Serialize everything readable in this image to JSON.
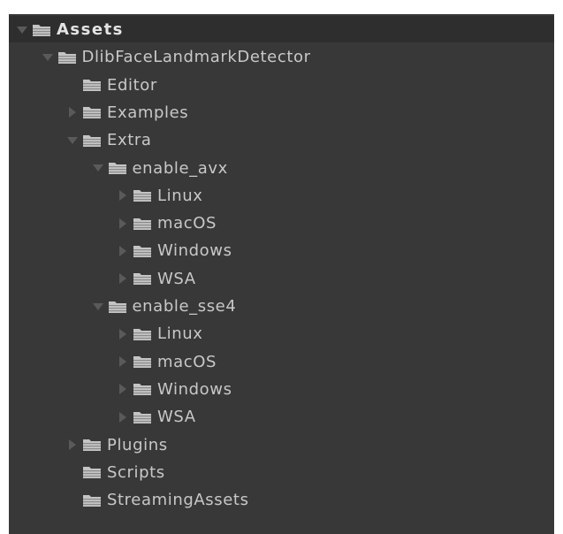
{
  "colors": {
    "panel_bg": "#383838",
    "header_bg": "#2e2e2e",
    "text": "#c8c8c8",
    "arrow": "#5a5a5a",
    "folder": "#c4c4c4"
  },
  "tree": {
    "rows": [
      {
        "label": "Assets",
        "depth": 0,
        "arrow": "expanded",
        "root": true
      },
      {
        "label": "DlibFaceLandmarkDetector",
        "depth": 1,
        "arrow": "expanded"
      },
      {
        "label": "Editor",
        "depth": 2,
        "arrow": "none"
      },
      {
        "label": "Examples",
        "depth": 2,
        "arrow": "collapsed"
      },
      {
        "label": "Extra",
        "depth": 2,
        "arrow": "expanded"
      },
      {
        "label": "enable_avx",
        "depth": 3,
        "arrow": "expanded"
      },
      {
        "label": "Linux",
        "depth": 4,
        "arrow": "collapsed"
      },
      {
        "label": "macOS",
        "depth": 4,
        "arrow": "collapsed"
      },
      {
        "label": "Windows",
        "depth": 4,
        "arrow": "collapsed"
      },
      {
        "label": "WSA",
        "depth": 4,
        "arrow": "collapsed"
      },
      {
        "label": "enable_sse4",
        "depth": 3,
        "arrow": "expanded"
      },
      {
        "label": "Linux",
        "depth": 4,
        "arrow": "collapsed"
      },
      {
        "label": "macOS",
        "depth": 4,
        "arrow": "collapsed"
      },
      {
        "label": "Windows",
        "depth": 4,
        "arrow": "collapsed"
      },
      {
        "label": "WSA",
        "depth": 4,
        "arrow": "collapsed"
      },
      {
        "label": "Plugins",
        "depth": 2,
        "arrow": "collapsed"
      },
      {
        "label": "Scripts",
        "depth": 2,
        "arrow": "none"
      },
      {
        "label": "StreamingAssets",
        "depth": 2,
        "arrow": "none"
      }
    ]
  }
}
